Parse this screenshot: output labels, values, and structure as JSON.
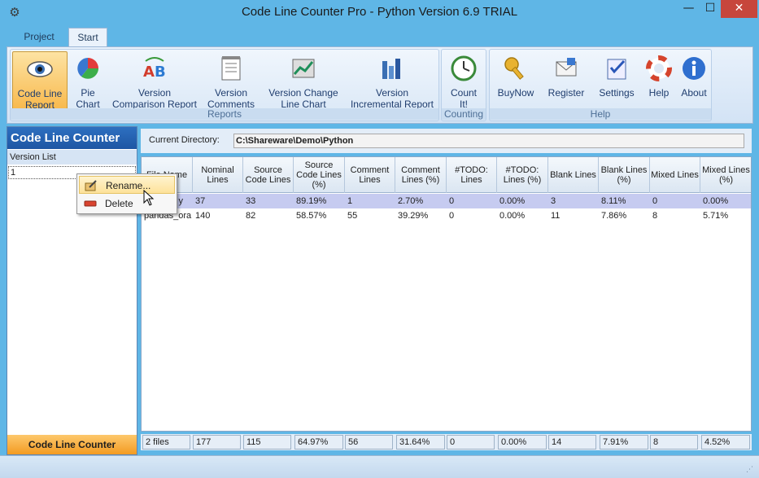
{
  "window": {
    "title": "Code Line Counter Pro - Python Version 6.9 TRIAL",
    "minimize": "—",
    "maximize": "☐",
    "close": "✕"
  },
  "tabs": [
    "Project",
    "Start"
  ],
  "ribbon": {
    "reports_group": "Reports",
    "counting_group": "Counting",
    "help_group": "Help",
    "buttons": {
      "code_line_report": "Code Line\nReport",
      "pie_chart": "Pie\nChart",
      "version_comparison": "Version\nComparison Report",
      "version_comments": "Version\nComments",
      "version_change": "Version Change\nLine Chart",
      "version_incremental": "Version\nIncremental Report",
      "count_it": "Count\nIt!",
      "buy_now": "BuyNow",
      "register": "Register",
      "settings": "Settings",
      "help": "Help",
      "about": "About"
    }
  },
  "sidebar": {
    "title": "Code Line Counter",
    "version_list_label": "Version List",
    "versions": [
      "1"
    ],
    "footer": "Code Line Counter"
  },
  "directory": {
    "label": "Current Directory:",
    "value": "C:\\Shareware\\Demo\\Python"
  },
  "table": {
    "columns": [
      "File Name",
      "Nominal\nLines",
      "Source\nCode Lines",
      "Source\nCode Lines\n(%)",
      "Comment\nLines",
      "Comment\nLines (%)",
      "#TODO:\nLines",
      "#TODO:\nLines (%)",
      "Blank Lines",
      "Blank Lines\n(%)",
      "Mixed Lines",
      "Mixed Lines\n(%)"
    ],
    "rows": [
      [
        "y",
        "37",
        "33",
        "89.19%",
        "1",
        "2.70%",
        "0",
        "0.00%",
        "3",
        "8.11%",
        "0",
        "0.00%"
      ],
      [
        "pandas_ora",
        "140",
        "82",
        "58.57%",
        "55",
        "39.29%",
        "0",
        "0.00%",
        "11",
        "7.86%",
        "8",
        "5.71%"
      ]
    ],
    "totals": [
      "2 files",
      "177",
      "115",
      "64.97%",
      "56",
      "31.64%",
      "0",
      "0.00%",
      "14",
      "7.91%",
      "8",
      "4.52%"
    ]
  },
  "context_menu": {
    "rename": "Rename...",
    "delete": "Delete"
  }
}
